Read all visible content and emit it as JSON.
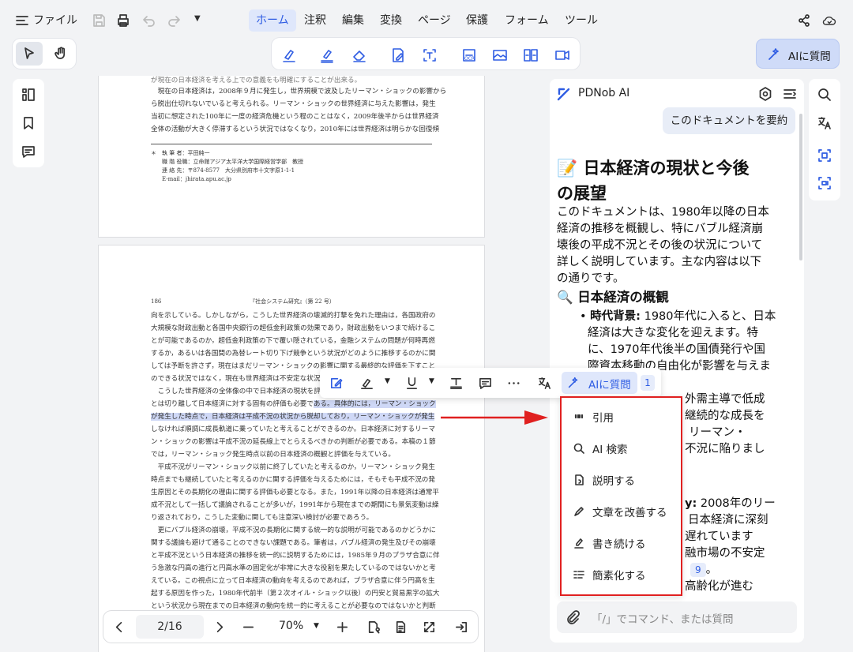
{
  "topbar": {
    "file_label": "ファイル",
    "tabs": [
      "ホーム",
      "注釈",
      "編集",
      "変換",
      "ページ",
      "保護",
      "フォーム",
      "ツール"
    ],
    "active_tab": "ホーム",
    "ask_ai_label": "AIに質問"
  },
  "document": {
    "page1_lines": [
      "が現在の日本経済を考える上での意義をも明確にすることが出来る。",
      "　現在の日本経済は，2008年９月に発生し，世界規模で波及したリーマン・ショックの影響から",
      "ら脱出仕切れないでいると考えられる。リーマン・ショックの世界経済に与えた影響は，発生",
      "当初に想定された100年に一度の経済危機という程のことはなく，2009年後半からは世界経済",
      "全体の活動が大きく停滞するという状況ではなくなり，2010年には世界経済は明らかな回復傾"
    ],
    "footnote_lines": [
      "＊　執 筆 者：平田純一",
      "　　職 階 役職：立命館アジア太平洋大学国際経営学部　教授",
      "　　連 絡 先：〒874-8577　大分県別府市十文字原1-1-1",
      "　　E-mail：jhirata.apu.ac.jp"
    ],
    "page2_header_left": "186",
    "page2_header_center": "『社会システム研究』（第 22 号）",
    "page2_lines": [
      "向を示している。しかしながら，こうした世界経済の壊滅的打撃を免れた理由は，各国政府の",
      "大規模な財政出動と各国中央銀行の超低金利政策の効果であり，財政出動をいつまで続けるこ",
      "とが可能であるのか，超低金利政策の下で覆い隠されている，金融システムの問題が何時再燃",
      "するか，あるいは各国間の為替レート切り下げ競争という状況がどのように推移するのかに関",
      "しては予断を許さず，現在はまだリーマン・ショックの影響に関する最終的な評価を下すこと",
      "のできる状況ではなく，現在も世界経済は不安定な状況にある。",
      "　こうした世界経済の全体像の中で日本経済の現状を評価する"
    ],
    "page2_hl_1_pre": "とは切り離して日本経済に対する固有の評価も必要で",
    "page2_hl_1": "ある。具体的には，リーマン・ショック",
    "page2_hl_2": "が発生した時点で，日本経済は平成不況の状況から脱却しており，リーマン・ショックが発生",
    "page2_lines_b": [
      "しなければ順調に成長軌道に乗っていたと考えることができるのか。日本経済に対するリーマ",
      "ン・ショックの影響は平成不況の延長線上でとらえるべきかの判断が必要である。本稿の１節",
      "では，リーマン・ショック発生時点以前の日本経済の概観と評価を与えている。",
      "　平成不況がリーマン・ショック以前に終了していたと考えるのか，リーマン・ショック発生",
      "時点までも継続していたと考えるのかに関する評価を与えるためには，そもそも平成不況の発",
      "生原因とその長期化の理由に関する評価も必要となる。また，1991年以降の日本経済は通常平",
      "成不況として一括して議論されることが多いが，1991年から現在までの期間にも景気変動は繰",
      "り返されており，こうした変動に関しても注意深い検討が必要であろう。",
      "　更にバブル経済の崩壊，平成不況の長期化に関する統一的な説明が可能であるのかどうかに",
      "関する議論も避けて通ることのできない課題である。筆者は，バブル経済の発生及びその崩壊",
      "と平成不況という日本経済の推移を統一的に説明するためには，1985年９月のプラザ合意に伴",
      "う急激な円高の進行と円高水準の固定化が非常に大きな役割を果たしているのではないかと考",
      "えている。この視点に立って日本経済の動向を考えるのであれば，プラザ合意に伴う円高を生",
      "起する原因を作った，1980年代前半（第２次オイル・ショック以後）の円安と貿易黒字の拡大",
      "という状況から現在までの日本経済の動向を統一的に考えることが必要なのではないかと判断"
    ]
  },
  "float_toolbar": {
    "ask_ai_label": "AIに質問",
    "ask_ai_count": "1"
  },
  "dropdown": {
    "items": [
      "引用",
      "AI 検索",
      "説明する",
      "文章を改善する",
      "書き続ける",
      "簡素化する"
    ]
  },
  "ai_panel": {
    "title": "PDNob AI",
    "user_message": "このドキュメントを要約",
    "heading_emoji": "📝",
    "heading_line1": "日本経済の現状と今後",
    "heading_line2": "の展望",
    "intro_lines": [
      "このドキュメントは、1980年以降の日本",
      "経済の推移を概観し、特にバブル経済崩",
      "壊後の平成不況とその後の状況について",
      "詳しく説明しています。主な内容は以下",
      "の通りです。"
    ],
    "section_emoji": "🔍",
    "section_title": "日本経済の概観",
    "bullet1_label": "時代背景:",
    "bullet1_first": " 1980年代に入ると、日本",
    "bullet1_lines": [
      "経済は大きな変化を迎えます。特",
      "に、1970年代後半の国債発行や国",
      "際資本移動の自由化が影響を与えま"
    ],
    "partial_lines": [
      "外需主導で低成",
      "継続的な成長を",
      "リーマン・",
      "不況に陥りまし"
    ],
    "bullet2_partial_label": "y:",
    "bullet2_partial_text": " 2008年のリー",
    "partial_lines2": [
      "日本経済に深刻",
      "遅れています",
      "融市場の不安定"
    ],
    "ref_2": "9",
    "after_ref": "。",
    "partial_last": "高齢化が進む",
    "input_placeholder": "「/」でコマンド、または質問"
  },
  "bottom_nav": {
    "page_indicator": "2/16",
    "zoom": "70%"
  }
}
